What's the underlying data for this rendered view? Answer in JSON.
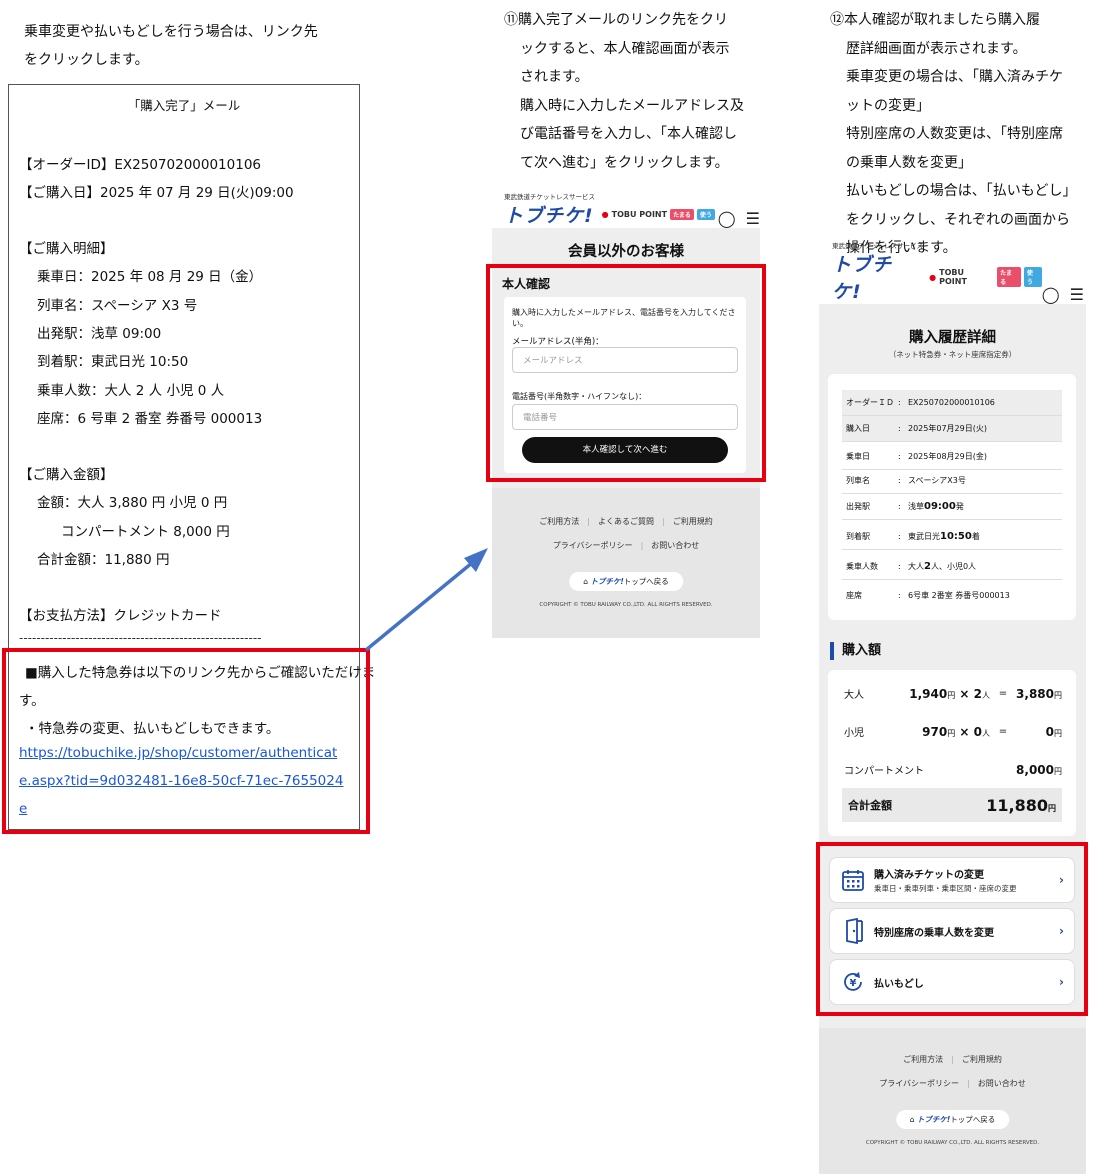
{
  "intro": {
    "line1": "乗車変更や払いもどしを行う場合は、リンク先",
    "line2": "をクリックします。"
  },
  "email": {
    "title": "「購入完了」メール",
    "order_id": "【オーダーID】EX250702000010106",
    "purchase_date": "【ご購入日】2025 年 07 月 29 日(火)09:00",
    "details_head": "【ご購入明細】",
    "ride_date": "乗車日：2025 年 08 月 29 日（金）",
    "train": "列車名：スペーシア X3 号",
    "departure": "出発駅：浅草 09:00",
    "arrival": "到着駅：東武日光 10:50",
    "passengers": "乗車人数：大人 2 人 小児 0 人",
    "seat": "座席：6 号車 2 番室 券番号 000013",
    "amount_head": "【ご購入金額】",
    "amount_line": "金額：大人 3,880 円 小児 0 円",
    "compartment": "コンパートメント 8,000 円",
    "total": "合計金額：11,880 円",
    "payment": "【お支払方法】クレジットカード",
    "divider": "--------------------------------------------------------",
    "notice1": "■購入した特急券は以下のリンク先からご確認いただけま",
    "notice1b": "す。",
    "notice2": "・特急券の変更、払いもどしもできます。",
    "link": "https://tobuchike.jp/shop/customer/authenticate.aspx?tid=9d032481-16e8-50cf-71ec-7655024e"
  },
  "step11": {
    "l1": "⑪購入完了メールのリンク先をクリ",
    "l2": "ックすると、本人確認画面が表示",
    "l3": "されます。",
    "l4": "購入時に入力したメールアドレス及",
    "l5": "び電話番号を入力し、「本人確認し",
    "l6": "て次へ進む」をクリックします。"
  },
  "step12": {
    "l1": "⑫本人確認が取れましたら購入履",
    "l2": "歴詳細画面が表示されます。",
    "l3": "乗車変更の場合は、「購入済みチケ",
    "l4": "ットの変更」",
    "l5": "特別座席の人数変更は、「特別座席",
    "l6": "の乗車人数を変更」",
    "l7": "払いもどしの場合は、「払いもどし」",
    "l8": "をクリックし、それぞれの画面から",
    "l9": "操作を行います。"
  },
  "brand": {
    "top": "東武鉄道チケットレスサービス",
    "logo": "トブチケ!",
    "point": "TOBU POINT",
    "chip1": "たまる",
    "chip2": "使う",
    "user_icon": "user-icon",
    "menu_icon": "menu-icon"
  },
  "screenA": {
    "heading": "会員以外のお客様",
    "card_title": "本人確認",
    "desc": "購入時に入力したメールアドレス、電話番号を入力してください。",
    "email_label": "メールアドレス(半角)：",
    "email_placeholder": "メールアドレス",
    "tel_label": "電話番号(半角数字・ハイフンなし)：",
    "tel_placeholder": "電話番号",
    "submit": "本人確認して次へ進む"
  },
  "footer": {
    "usage": "ご利用方法",
    "faq": "よくあるご質問",
    "terms": "ご利用規約",
    "privacy": "プライバシーポリシー",
    "contact": "お問い合わせ",
    "top_logo": "トブチケ!",
    "top_label": "トップへ戻る",
    "copyright": "COPYRIGHT © TOBU RAILWAY CO.,LTD. ALL RIGHTS RESERVED."
  },
  "screenB": {
    "title": "購入履歴詳細",
    "subtitle": "（ネット特急券・ネット座席指定券）",
    "rows": [
      {
        "k": "オーダーＩＤ",
        "v": "EX250702000010106"
      },
      {
        "k": "購入日",
        "v": "2025年07月29日(火)"
      },
      {
        "k": "乗車日",
        "v": "2025年08月29日(金)"
      },
      {
        "k": "列車名",
        "v": "スペーシアX3号"
      },
      {
        "k": "出発駅",
        "v": "浅草",
        "vb": "09:00",
        "vs": "発"
      },
      {
        "k": "到着駅",
        "v": "東武日光",
        "vb": "10:50",
        "vs": "着"
      },
      {
        "k": "乗車人数",
        "v": "大人",
        "vb": "2",
        "vs": "人、小児0人"
      },
      {
        "k": "座席",
        "v": "6号車 2番室 券番号000013"
      }
    ],
    "amount_head": "購入額",
    "adult_label": "大人",
    "adult_price": "1,940",
    "adult_qty": "2",
    "adult_total": "3,880",
    "child_label": "小児",
    "child_price": "970",
    "child_qty": "0",
    "child_total": "0",
    "compartment_label": "コンパートメント",
    "compartment_total": "8,000",
    "total_label": "合計金額",
    "total": "11,880",
    "yen": "円",
    "person": "人",
    "times": "×",
    "eq": "=",
    "actions": [
      {
        "t1": "購入済みチケットの変更",
        "t2": "乗車日・乗車列車・乗車区間・座席の変更",
        "icon": "calendar-icon"
      },
      {
        "t1": "特別座席の乗車人数を変更",
        "t2": "",
        "icon": "door-icon"
      },
      {
        "t1": "払いもどし",
        "t2": "",
        "icon": "refund-yen-icon"
      }
    ]
  },
  "colors": {
    "highlight": "#e60012",
    "brand_blue": "#1f4aa8",
    "link": "#1a56db",
    "arrow": "#4472c4"
  }
}
